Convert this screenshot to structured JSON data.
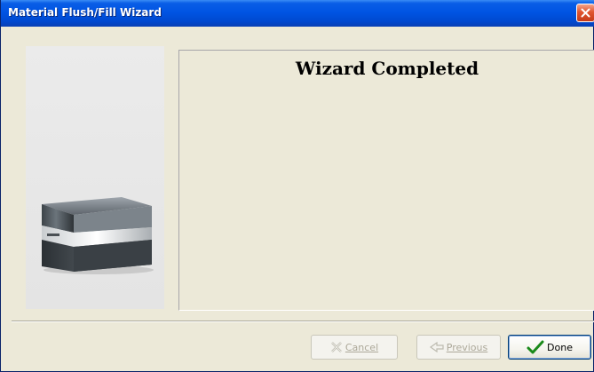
{
  "window": {
    "title": "Material Flush/Fill Wizard",
    "close_icon": "close-icon"
  },
  "content": {
    "heading": "Wizard Completed"
  },
  "left_panel": {
    "image_icon": "printer-icon"
  },
  "buttons": {
    "cancel": {
      "label": "Cancel",
      "enabled": false,
      "icon": "cancel-x-icon"
    },
    "previous": {
      "label": "Previous",
      "enabled": false,
      "icon": "previous-arrow-icon"
    },
    "done": {
      "label": "Done",
      "enabled": true,
      "icon": "checkmark-icon"
    }
  },
  "colors": {
    "titlebar": "#0054e3",
    "dialog_bg": "#ece9d8",
    "checkmark": "#1a8a1a",
    "close_button": "#e0552f"
  }
}
